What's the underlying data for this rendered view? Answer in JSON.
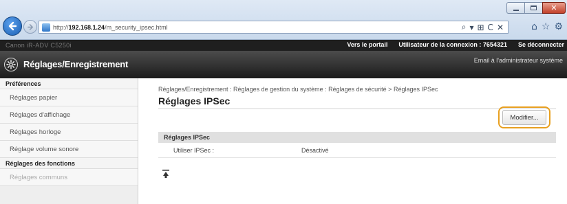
{
  "browser": {
    "url_prefix": "http://",
    "url_host": "192.168.1.24",
    "url_path": "/m_security_ipsec.html",
    "addr_tools": [
      "⌕",
      "▾",
      "⊞",
      "C",
      "✕"
    ],
    "tab_icons": [
      "⌂",
      "☆",
      "⚙"
    ]
  },
  "topbar": {
    "device_name": "Canon iR-ADV C5250i",
    "portal_link": "Vers le portail",
    "user_label": "Utilisateur de la connexion :",
    "user_value": "7654321",
    "logout_link": "Se déconnecter"
  },
  "header": {
    "title": "Réglages/Enregistrement",
    "admin_mail_link": "Email à l'administrateur système"
  },
  "sidebar": {
    "section1_title": "Préférences",
    "section1_items": [
      "Réglages papier",
      "Réglages d'affichage",
      "Réglages horloge",
      "Réglage volume sonore"
    ],
    "section2_title": "Réglages des fonctions",
    "section2_items": [
      "Réglages communs"
    ]
  },
  "main": {
    "breadcrumb": "Réglages/Enregistrement : Réglages de gestion du système : Réglages de sécurité > Réglages IPSec",
    "page_title": "Réglages IPSec",
    "modify_button": "Modifier...",
    "section_title": "Réglages IPSec",
    "setting_label": "Utiliser IPSec :",
    "setting_value": "Désactivé"
  },
  "colors": {
    "highlight": "#e8a020",
    "header_bg": "#2a2a2a",
    "topbar_bg": "#1f1f1f"
  }
}
